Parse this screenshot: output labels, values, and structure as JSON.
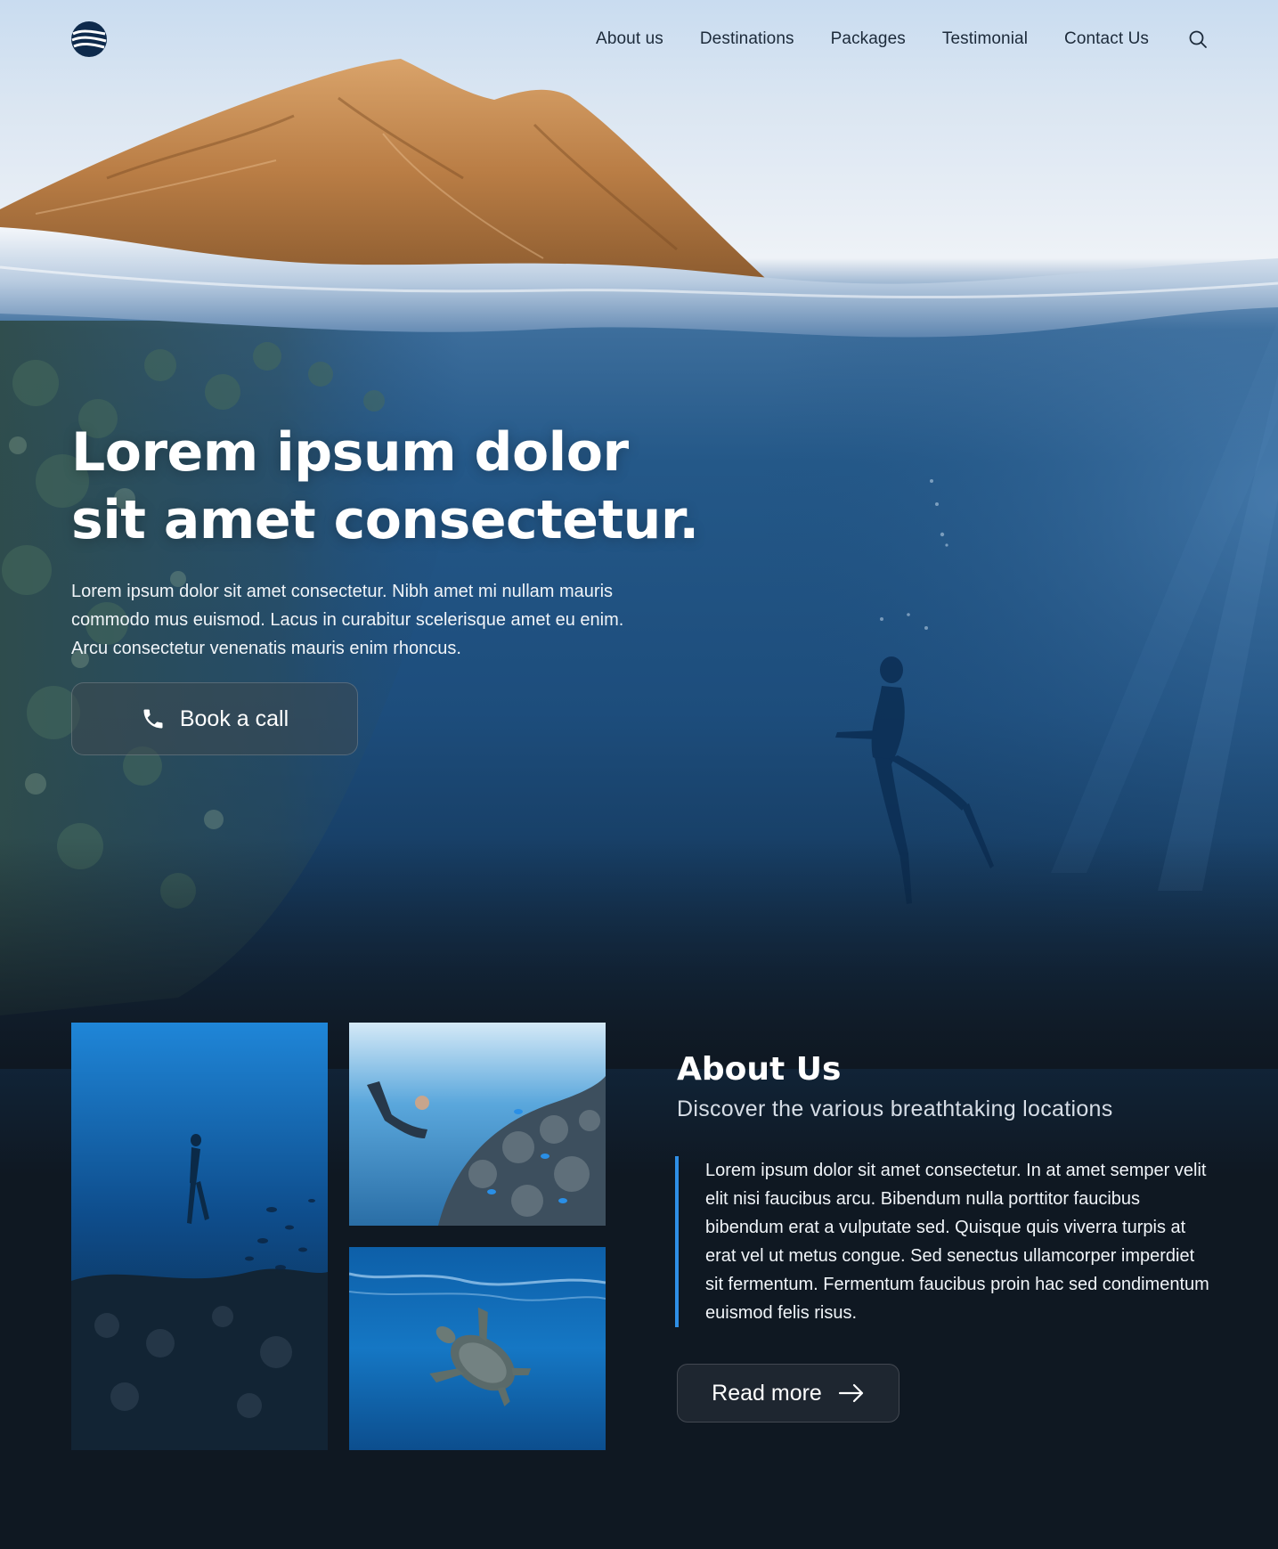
{
  "nav": {
    "logo_icon": "wave-globe-logo",
    "items": [
      {
        "label": "About us"
      },
      {
        "label": "Destinations"
      },
      {
        "label": "Packages"
      },
      {
        "label": "Testimonial"
      },
      {
        "label": "Contact Us"
      }
    ],
    "search_icon": "search-icon"
  },
  "hero": {
    "title": "Lorem ipsum dolor sit amet consectetur.",
    "text": "Lorem ipsum dolor sit amet consectetur. Nibh amet mi nullam mauris commodo mus euismod. Lacus in curabitur scelerisque amet eu enim. Arcu consectetur venenatis mauris enim rhoncus.",
    "cta": {
      "label": "Book a call",
      "icon": "phone-icon"
    }
  },
  "about": {
    "title": "About Us",
    "subtitle": "Discover the various breathtaking locations",
    "body": "Lorem ipsum dolor sit amet consectetur. In at amet semper velit elit nisi faucibus arcu. Bibendum nulla porttitor faucibus bibendum erat a vulputate sed. Quisque quis viverra turpis at erat vel ut metus congue. Sed senectus ullamcorper imperdiet sit fermentum. Fermentum faucibus proin hac sed condimentum euismod felis risus.",
    "cta": {
      "label": "Read more",
      "icon": "arrow-right-icon"
    },
    "photos": [
      "diver-descending-photo",
      "diver-coral-reef-photo",
      "sea-turtle-photo"
    ]
  },
  "colors": {
    "accent": "#2f8fe6",
    "background_dark": "#0f1822",
    "nav_text": "#1c2a3a"
  }
}
